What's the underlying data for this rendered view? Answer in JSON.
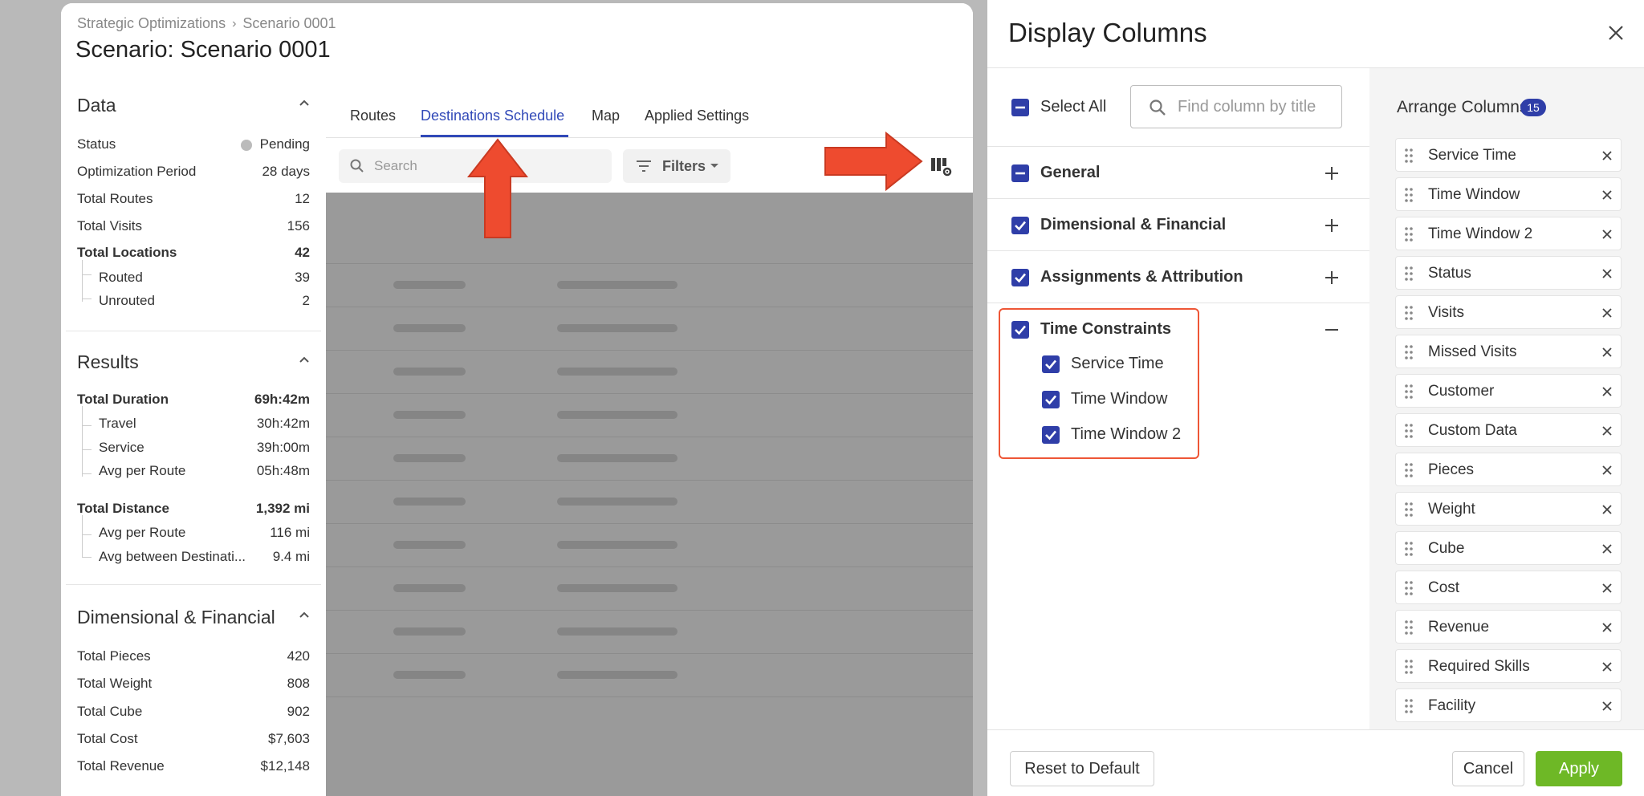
{
  "breadcrumb": {
    "parent": "Strategic Optimizations",
    "current": "Scenario 0001"
  },
  "page_title": "Scenario: Scenario 0001",
  "data_section": {
    "title": "Data",
    "rows": [
      {
        "label": "Status",
        "value": "Pending"
      },
      {
        "label": "Optimization Period",
        "value": "28 days"
      },
      {
        "label": "Total Routes",
        "value": "12"
      },
      {
        "label": "Total Visits",
        "value": "156"
      },
      {
        "label": "Total Locations",
        "value": "42"
      },
      {
        "label": "Routed",
        "value": "39"
      },
      {
        "label": "Unrouted",
        "value": "2"
      }
    ]
  },
  "results_section": {
    "title": "Results",
    "rows": [
      {
        "label": "Total Duration",
        "value": "69h:42m"
      },
      {
        "label": "Travel",
        "value": "30h:42m"
      },
      {
        "label": "Service",
        "value": "39h:00m"
      },
      {
        "label": "Avg per Route",
        "value": "05h:48m"
      },
      {
        "label": "Total Distance",
        "value": "1,392 mi"
      },
      {
        "label": "Avg per Route",
        "value": "116 mi"
      },
      {
        "label": "Avg between Destinati...",
        "value": "9.4 mi"
      }
    ]
  },
  "dimensional_section": {
    "title": "Dimensional & Financial",
    "rows": [
      {
        "label": "Total Pieces",
        "value": "420"
      },
      {
        "label": "Total Weight",
        "value": "808"
      },
      {
        "label": "Total Cube",
        "value": "902"
      },
      {
        "label": "Total Cost",
        "value": "$7,603"
      },
      {
        "label": "Total Revenue",
        "value": "$12,148"
      }
    ]
  },
  "tabs": [
    "Routes",
    "Destinations Schedule",
    "Map",
    "Applied Settings"
  ],
  "active_tab": "Destinations Schedule",
  "search": {
    "placeholder": "Search"
  },
  "filters_label": "Filters",
  "drawer": {
    "title": "Display Columns",
    "select_all": "Select All",
    "find_placeholder": "Find column by title",
    "groups": [
      {
        "label": "General",
        "state": "indeterminate",
        "expanded": false
      },
      {
        "label": "Dimensional & Financial",
        "state": "checked",
        "expanded": false
      },
      {
        "label": "Assignments & Attribution",
        "state": "checked",
        "expanded": false
      },
      {
        "label": "Time Constraints",
        "state": "checked",
        "expanded": true,
        "children": [
          "Service Time",
          "Time Window",
          "Time Window 2"
        ]
      }
    ],
    "arrange_title": "Arrange Columns",
    "arrange_count": "15",
    "arrange_items": [
      "Service Time",
      "Time Window",
      "Time Window 2",
      "Status",
      "Visits",
      "Missed Visits",
      "Customer",
      "Custom Data",
      "Pieces",
      "Weight",
      "Cube",
      "Cost",
      "Revenue",
      "Required Skills",
      "Facility"
    ],
    "reset_label": "Reset to Default",
    "cancel_label": "Cancel",
    "apply_label": "Apply"
  },
  "colors": {
    "accent": "#2f3ea8",
    "tab_active": "#3149b8",
    "apply": "#6eb826",
    "annotation": "#ee4b2f"
  },
  "icons": [
    "chevron-right-icon",
    "chevron-up-icon",
    "search-icon",
    "filter-icon",
    "columns-settings-icon",
    "close-icon",
    "plus-icon",
    "minus-icon",
    "drag-handle-icon",
    "remove-icon",
    "arrow-up-icon",
    "arrow-right-icon"
  ]
}
